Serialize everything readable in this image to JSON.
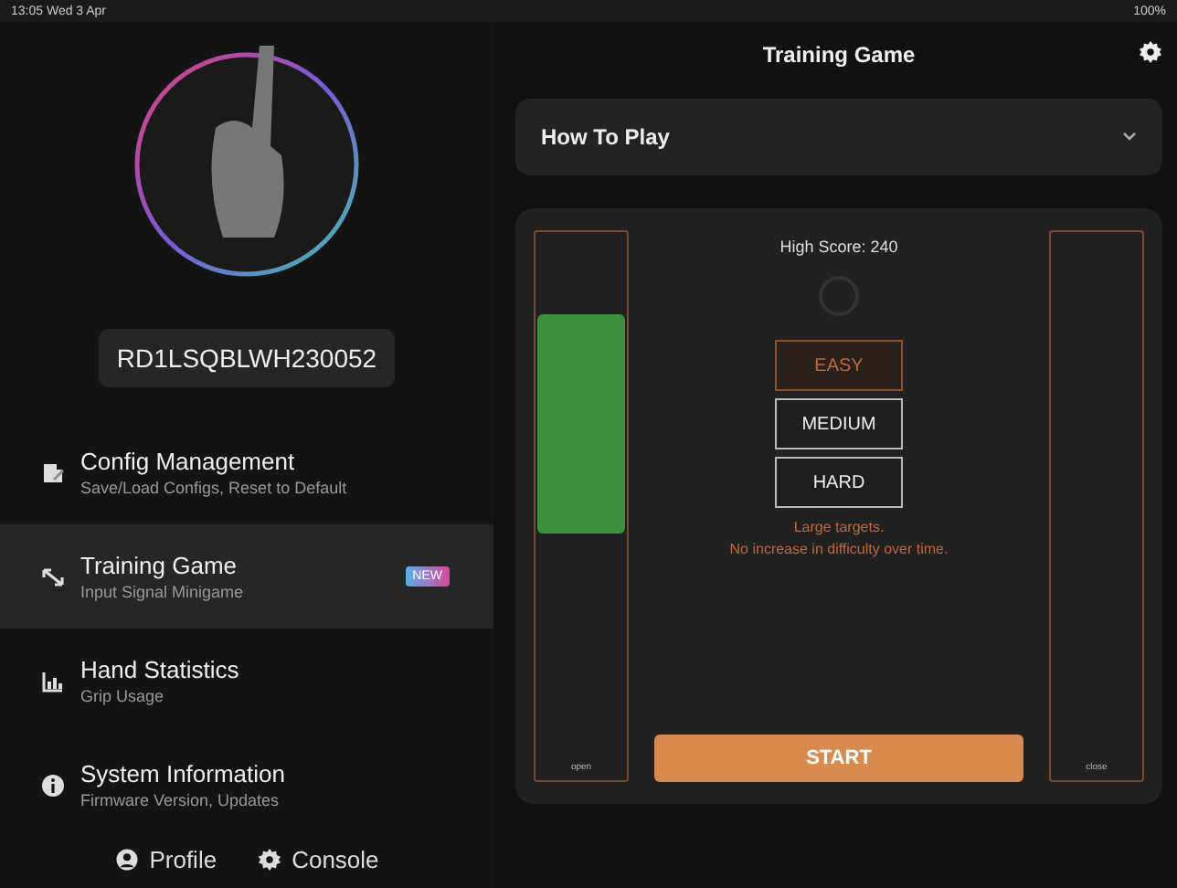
{
  "status_bar": {
    "time": "13:05  Wed 3 Apr",
    "battery": "100%"
  },
  "sidebar": {
    "device_id": "RD1LSQBLWH230052",
    "items": [
      {
        "title": "Config Management",
        "subtitle": "Save/Load Configs, Reset to Default",
        "kind": "config",
        "selected": false
      },
      {
        "title": "Training Game",
        "subtitle": "Input Signal Minigame",
        "kind": "game",
        "selected": true,
        "badge": "NEW"
      },
      {
        "title": "Hand Statistics",
        "subtitle": "Grip Usage",
        "kind": "stats",
        "selected": false
      },
      {
        "title": "System Information",
        "subtitle": "Firmware Version, Updates",
        "kind": "info",
        "selected": false
      }
    ],
    "footer": [
      {
        "label": "Profile",
        "kind": "profile"
      },
      {
        "label": "Console",
        "kind": "console"
      }
    ]
  },
  "header": {
    "title": "Training Game"
  },
  "how_to_play": {
    "label": "How To Play",
    "expanded": false
  },
  "game": {
    "high_score": "High Score: 240",
    "left_meter_label": "open",
    "right_meter_label": "close",
    "difficulties": [
      {
        "label": "EASY",
        "selected": true
      },
      {
        "label": "MEDIUM",
        "selected": false
      },
      {
        "label": "HARD",
        "selected": false
      }
    ],
    "description": [
      "Large targets.",
      "No increase in difficulty over time."
    ],
    "start": "START"
  }
}
